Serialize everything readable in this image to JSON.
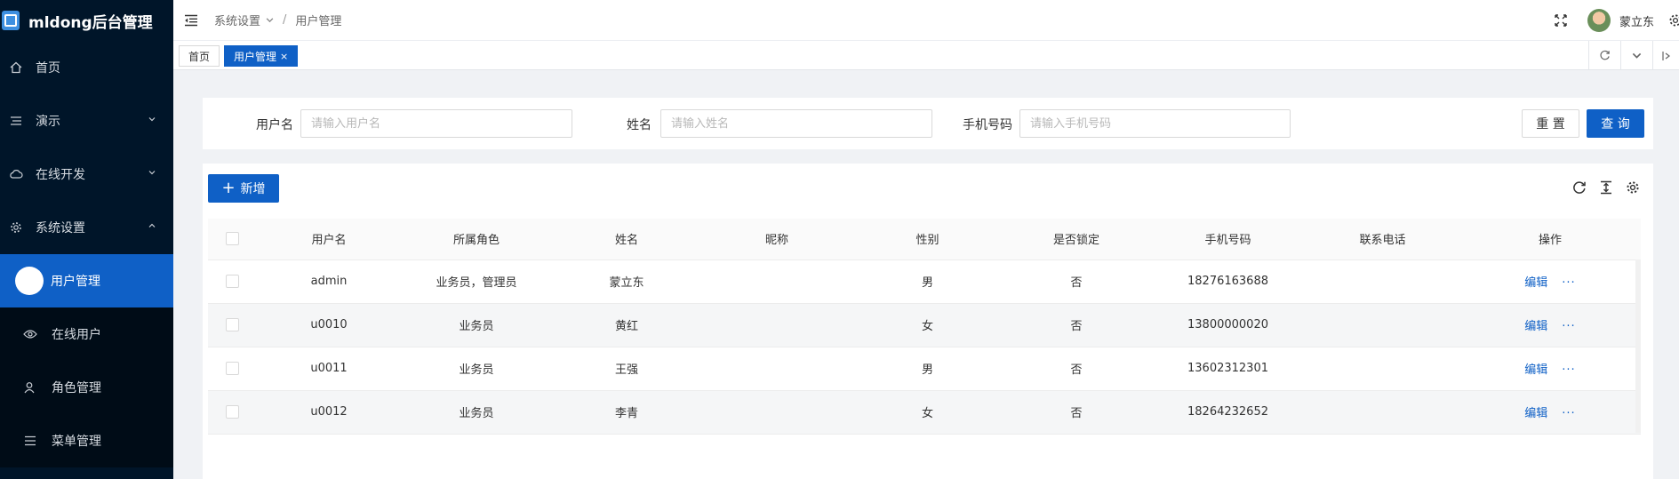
{
  "app": {
    "title": "mldong后台管理"
  },
  "sidebar": {
    "items": [
      {
        "label": "首页",
        "icon": "home-icon"
      },
      {
        "label": "演示",
        "icon": "list-icon"
      },
      {
        "label": "在线开发",
        "icon": "cloud-icon"
      },
      {
        "label": "系统设置",
        "icon": "gear-icon"
      }
    ],
    "sub_items": [
      {
        "label": "用户管理",
        "active": true
      },
      {
        "label": "在线用户",
        "icon": "eye-icon"
      },
      {
        "label": "角色管理",
        "icon": "user-icon"
      },
      {
        "label": "菜单管理",
        "icon": "menu-icon"
      }
    ]
  },
  "header": {
    "breadcrumb": [
      "系统设置",
      "用户管理"
    ],
    "user_name": "蒙立东"
  },
  "tabs": [
    {
      "label": "首页"
    },
    {
      "label": "用户管理",
      "close": "×"
    }
  ],
  "search": {
    "username_label": "用户名",
    "username_placeholder": "请输入用户名",
    "realname_label": "姓名",
    "realname_placeholder": "请输入姓名",
    "mobile_label": "手机号码",
    "mobile_placeholder": "请输入手机号码",
    "reset_label": "重 置",
    "query_label": "查 询"
  },
  "toolbar": {
    "add_label": "新增",
    "add_icon": "+"
  },
  "table": {
    "columns": [
      "用户名",
      "所属角色",
      "姓名",
      "昵称",
      "性别",
      "是否锁定",
      "手机号码",
      "联系电话",
      "操作"
    ],
    "rows": [
      {
        "username": "admin",
        "roles": "业务员，管理员",
        "realname": "蒙立东",
        "nickname": "",
        "gender": "男",
        "locked": "否",
        "mobile": "18276163688",
        "phone": ""
      },
      {
        "username": "u0010",
        "roles": "业务员",
        "realname": "黄红",
        "nickname": "",
        "gender": "女",
        "locked": "否",
        "mobile": "13800000020",
        "phone": ""
      },
      {
        "username": "u0011",
        "roles": "业务员",
        "realname": "王强",
        "nickname": "",
        "gender": "男",
        "locked": "否",
        "mobile": "13602312301",
        "phone": ""
      },
      {
        "username": "u0012",
        "roles": "业务员",
        "realname": "李青",
        "nickname": "",
        "gender": "女",
        "locked": "否",
        "mobile": "18264232652",
        "phone": ""
      }
    ],
    "edit_label": "编辑",
    "more_label": "···"
  },
  "colors": {
    "sidebar_bg": "#001529",
    "primary": "#0f60c6"
  }
}
